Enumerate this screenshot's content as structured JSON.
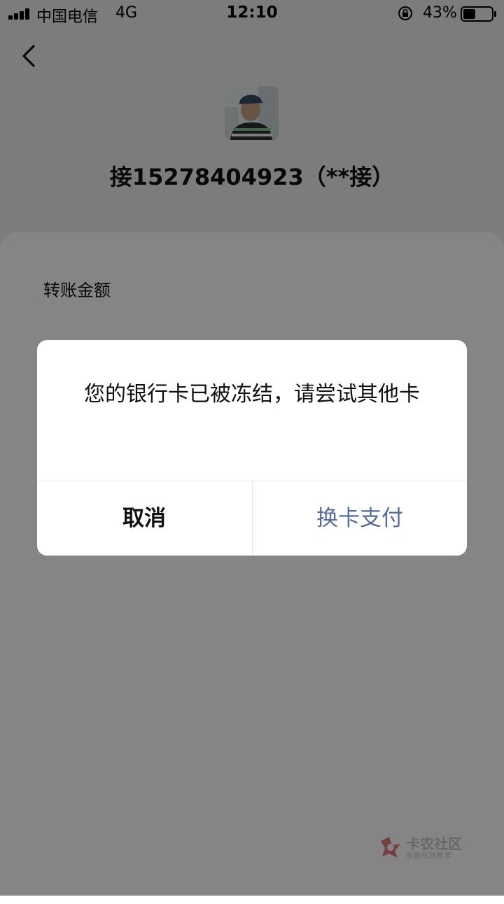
{
  "status_bar": {
    "carrier": "中国电信",
    "network": "4G",
    "time": "12:10",
    "battery_percent": "43%",
    "battery_level": 0.43
  },
  "header": {
    "payee_name": "接15278404923（**接）",
    "back_icon": "chevron-left-icon"
  },
  "form": {
    "amount_label": "转账金额"
  },
  "dialog": {
    "message": "您的银行卡已被冻结，请尝试其他卡",
    "cancel_label": "取消",
    "confirm_label": "换卡支付",
    "confirm_color": "#576b95"
  },
  "watermark": {
    "title": "卡农社区",
    "subtitle": "金融在线教育"
  }
}
